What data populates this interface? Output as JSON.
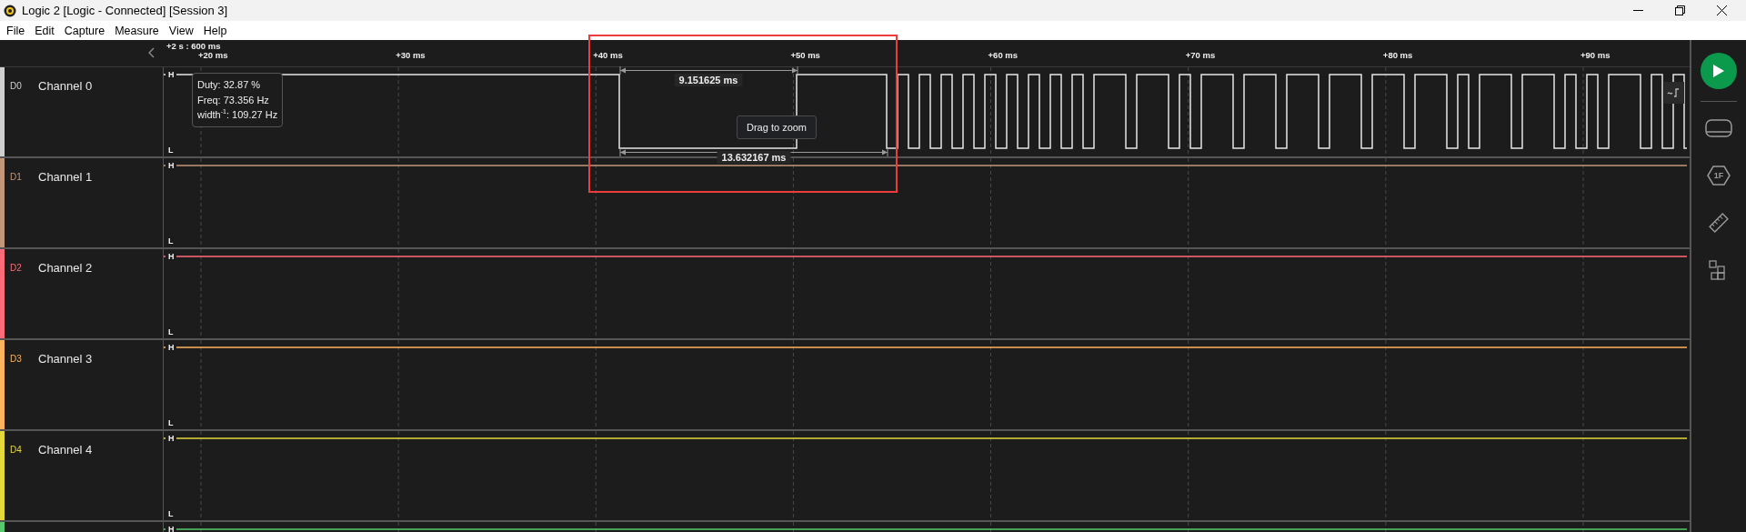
{
  "window": {
    "title": "Logic 2 [Logic - Connected] [Session 3]"
  },
  "menu": [
    "File",
    "Edit",
    "Capture",
    "Measure",
    "View",
    "Help"
  ],
  "timeline": {
    "origin": "+2 s : 600 ms",
    "ticks": [
      "+20 ms",
      "+30 ms",
      "+40 ms",
      "+50 ms",
      "+60 ms",
      "+70 ms",
      "+80 ms",
      "+90 ms"
    ]
  },
  "channels": [
    {
      "label": "D0",
      "name": "Channel 0",
      "color": "#cfcfcf",
      "kind": "pulses",
      "high_mark": "H",
      "low_mark": "L"
    },
    {
      "label": "D1",
      "name": "Channel 1",
      "color": "#c4967a",
      "kind": "flat",
      "high_mark": "H",
      "low_mark": "L"
    },
    {
      "label": "D2",
      "name": "Channel 2",
      "color": "#ff6b78",
      "kind": "flat",
      "high_mark": "H",
      "low_mark": "L"
    },
    {
      "label": "D3",
      "name": "Channel 3",
      "color": "#ffb35c",
      "kind": "flat",
      "high_mark": "H",
      "low_mark": "L"
    },
    {
      "label": "D4",
      "name": "Channel 4",
      "color": "#e5d83a",
      "kind": "flat",
      "high_mark": "H",
      "low_mark": "L"
    },
    {
      "color": "#55c96c",
      "kind": "flat",
      "high_mark": "H"
    }
  ],
  "measurement_tooltip": {
    "lines": [
      "Duty: 32.87 %",
      "Freq: 73.356 Hz",
      "width$^{-1}$: 109.27 Hz"
    ]
  },
  "pulse_width": "9.151625 ms",
  "period": "13.632167 ms",
  "zoom_hint": "Drag to zoom",
  "sidebar": {
    "extension_badge": "1F"
  }
}
